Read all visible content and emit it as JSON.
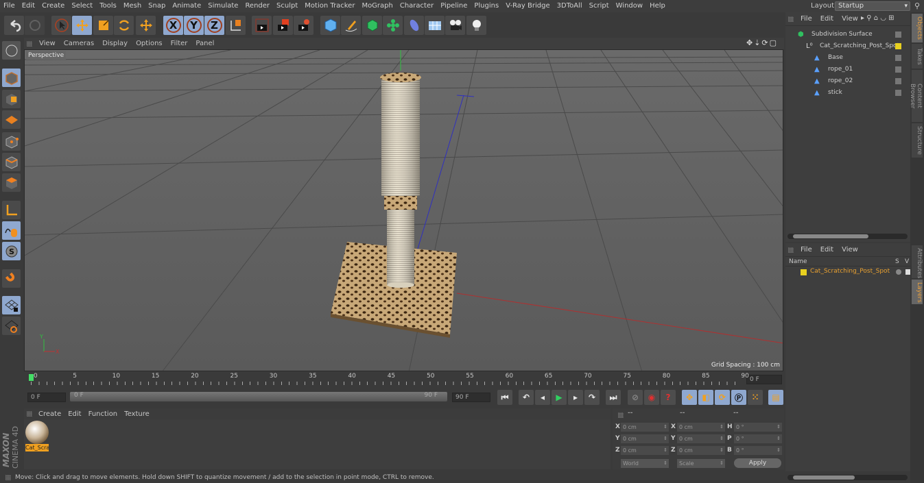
{
  "menubar": {
    "items": [
      "File",
      "Edit",
      "Create",
      "Select",
      "Tools",
      "Mesh",
      "Snap",
      "Animate",
      "Simulate",
      "Render",
      "Sculpt",
      "Motion Tracker",
      "MoGraph",
      "Character",
      "Pipeline",
      "Plugins",
      "V-Ray Bridge",
      "3DToAll",
      "Script",
      "Window",
      "Help"
    ],
    "layout_label": "Layout:",
    "layout_value": "Startup"
  },
  "toolbar": {
    "icons": [
      "undo-icon",
      "redo-icon",
      "live-selection-icon",
      "move-icon",
      "scale-icon",
      "rotate-icon",
      "recent-tool-icon",
      "x-axis-lock-icon",
      "y-axis-lock-icon",
      "z-axis-lock-icon",
      "coordinate-system-icon",
      "render-view-icon",
      "render-picture-viewer-icon",
      "render-settings-icon",
      "cube-primitive-icon",
      "pen-spline-icon",
      "subdivision-surface-icon",
      "cloner-icon",
      "deformer-icon",
      "floor-environment-icon",
      "camera-icon",
      "light-icon"
    ],
    "axis_labels": [
      "X",
      "Y",
      "Z"
    ]
  },
  "left_toolbar": {
    "icons": [
      "make-editable-icon",
      "model-mode-icon",
      "texture-mode-icon",
      "workplane-mode-icon",
      "points-mode-icon",
      "edges-mode-icon",
      "polygons-mode-icon",
      "axis-mode-icon",
      "tweak-mode-icon",
      "solo-mode-icon",
      "snapping-icon",
      "workplane-lock-icon",
      "workplane-snap-icon"
    ]
  },
  "viewport": {
    "menu": [
      "View",
      "Cameras",
      "Display",
      "Options",
      "Filter",
      "Panel"
    ],
    "camera_label": "Perspective",
    "grid_spacing": "Grid Spacing : 100 cm",
    "axis_x": "X",
    "axis_y": "Y",
    "colors": {
      "x_axis": "#c03030",
      "y_axis": "#30c030",
      "z_axis": "#3030c0",
      "bg": "#5f5f5f"
    }
  },
  "timeline": {
    "ticks": [
      "0",
      "5",
      "10",
      "15",
      "20",
      "25",
      "30",
      "35",
      "40",
      "45",
      "50",
      "55",
      "60",
      "65",
      "70",
      "75",
      "80",
      "85",
      "90"
    ],
    "current_frame": "0 F",
    "start_field": "0 F",
    "range_start": "0 F",
    "range_end": "90 F",
    "end_field": "90 F",
    "playhead_color": "#44dd66"
  },
  "transport": {
    "buttons": [
      "go-to-start",
      "previous-key",
      "previous-frame",
      "play",
      "next-frame",
      "next-key",
      "go-to-end"
    ],
    "record_buttons": [
      "record-active-objects",
      "autokeying",
      "keyframe-selection"
    ],
    "key_buttons": [
      "key-position",
      "key-scale",
      "key-rotation",
      "key-parameter",
      "key-point-level",
      "timeline-window"
    ]
  },
  "material_manager": {
    "menu": [
      "Create",
      "Edit",
      "Function",
      "Texture"
    ],
    "materials": [
      {
        "name": "Cat_Scra"
      }
    ],
    "brand_1": "MAXON",
    "brand_2": "CINEMA 4D"
  },
  "coordinates": {
    "headers": [
      "--",
      "--",
      "--"
    ],
    "rows": [
      {
        "l1": "X",
        "v1": "0 cm",
        "l2": "X",
        "v2": "0 cm",
        "l3": "H",
        "v3": "0 °"
      },
      {
        "l1": "Y",
        "v1": "0 cm",
        "l2": "Y",
        "v2": "0 cm",
        "l3": "P",
        "v3": "0 °"
      },
      {
        "l1": "Z",
        "v1": "0 cm",
        "l2": "Z",
        "v2": "0 cm",
        "l3": "B",
        "v3": "0 °"
      }
    ],
    "space": "World",
    "mode": "Scale",
    "apply": "Apply"
  },
  "status": "Move: Click and drag to move elements. Hold down SHIFT to quantize movement / add to the selection in point mode, CTRL to remove.",
  "object_manager": {
    "menu": [
      "File",
      "Edit",
      "View"
    ],
    "objects": [
      {
        "name": "Subdivision Surface",
        "depth": 0,
        "icon": "subdivision-surface-icon"
      },
      {
        "name": "Cat_Scratching_Post_Spot",
        "depth": 1,
        "icon": "null-object-icon"
      },
      {
        "name": "Base",
        "depth": 2,
        "icon": "polygon-object-icon"
      },
      {
        "name": "rope_01",
        "depth": 2,
        "icon": "polygon-object-icon"
      },
      {
        "name": "rope_02",
        "depth": 2,
        "icon": "polygon-object-icon"
      },
      {
        "name": "stick",
        "depth": 2,
        "icon": "polygon-object-icon"
      }
    ]
  },
  "layer_manager": {
    "menu": [
      "File",
      "Edit",
      "View"
    ],
    "col_name": "Name",
    "col_s": "S",
    "col_v": "V",
    "layers": [
      {
        "name": "Cat_Scratching_Post_Spot",
        "color": "#e8d020"
      }
    ]
  },
  "side_tabs": {
    "top": [
      "Objects",
      "Takes",
      "Content Browser",
      "Structure"
    ],
    "bottom": [
      "Attributes",
      "Layers"
    ]
  }
}
